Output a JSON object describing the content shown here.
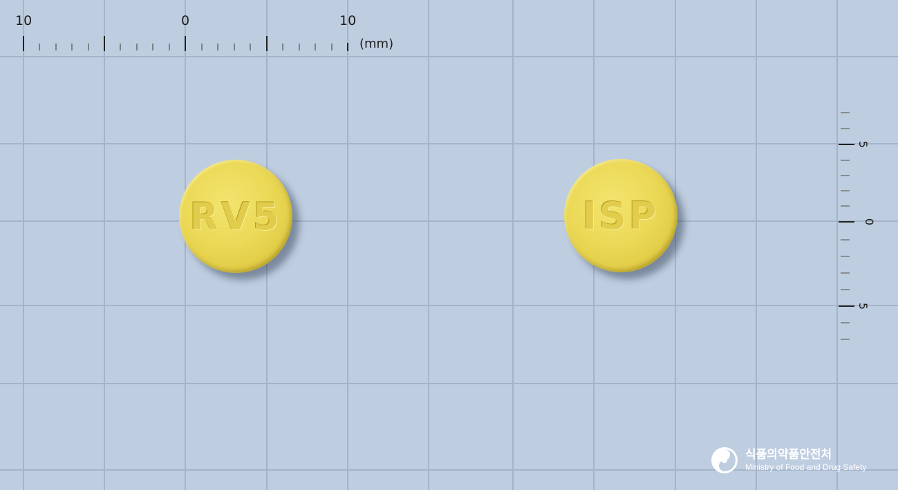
{
  "ruler": {
    "label_left": "10",
    "label_center": "0",
    "label_right": "10",
    "unit": "(mm)"
  },
  "vertical_ruler": {
    "label_top": "5",
    "label_center": "0",
    "label_bottom": "5"
  },
  "pills": [
    {
      "imprint": "RV5",
      "color": "#ebd957"
    },
    {
      "imprint": "ISP",
      "color": "#ebd957"
    }
  ],
  "logo": {
    "korean": "식품의약품안전처",
    "english": "Ministry of Food and Drug Safety"
  },
  "colors": {
    "background": "#bfcde0",
    "grid": "#a6b7cc"
  }
}
